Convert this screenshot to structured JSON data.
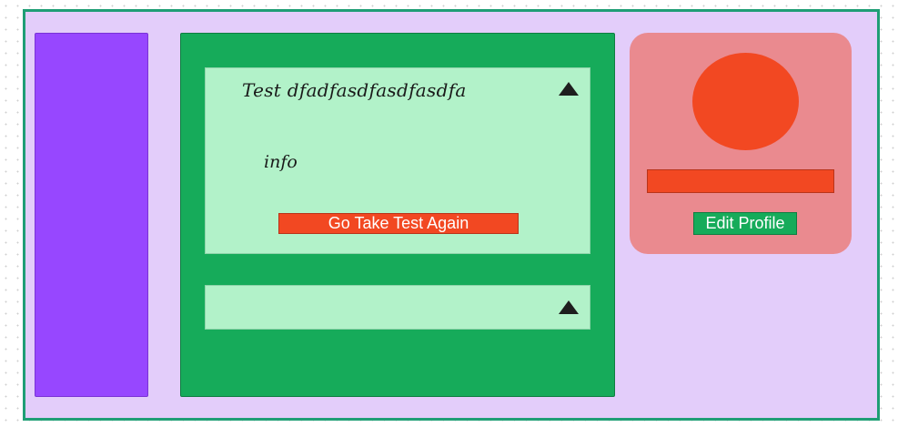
{
  "test_card": {
    "title": "Test dfadfasdfasdfasdfa",
    "info": "info",
    "retake_button": "Go Take Test Again",
    "toggle_icon": "triangle-up-icon"
  },
  "collapsed_card": {
    "toggle_icon": "triangle-up-icon"
  },
  "profile": {
    "edit_button": "Edit Profile"
  },
  "colors": {
    "frame_bg": "#e3cdfa",
    "frame_border": "#1f9e75",
    "sidebar": "#9747ff",
    "main_panel": "#16ab5a",
    "card": "#b2f2c9",
    "profile_card": "#ea8a8f",
    "accent_red": "#f24822",
    "button_green": "#16ab5a"
  }
}
